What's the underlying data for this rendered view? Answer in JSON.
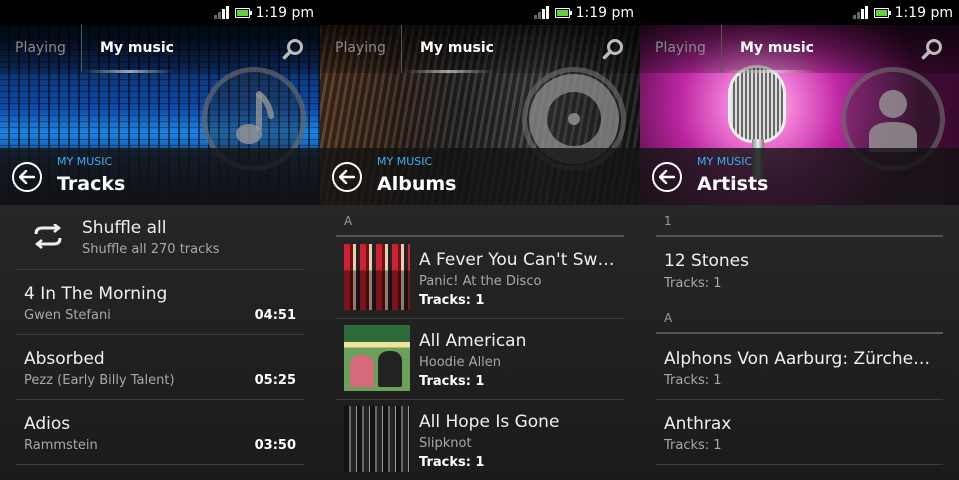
{
  "status": {
    "time": "1:19 pm"
  },
  "tabs": {
    "playing": "Playing",
    "my_music": "My music"
  },
  "panels": [
    {
      "crumb": "MY MUSIC",
      "title": "Tracks",
      "shuffle": {
        "label": "Shuffle all",
        "sub": "Shuffle all 270 tracks"
      },
      "tracks": [
        {
          "title": "4 In The Morning",
          "artist": "Gwen Stefani",
          "duration": "04:51"
        },
        {
          "title": "Absorbed",
          "artist": "Pezz (Early Billy Talent)",
          "duration": "05:25"
        },
        {
          "title": "Adios",
          "artist": "Rammstein",
          "duration": "03:50"
        }
      ]
    },
    {
      "crumb": "MY MUSIC",
      "title": "Albums",
      "section": "A",
      "albums": [
        {
          "title": "A Fever You Can't Swe...",
          "artist": "Panic! At the Disco",
          "tracks": "Tracks: 1"
        },
        {
          "title": "All American",
          "artist": "Hoodie Allen",
          "tracks": "Tracks: 1"
        },
        {
          "title": "All Hope Is Gone",
          "artist": "Slipknot",
          "tracks": "Tracks: 1"
        }
      ]
    },
    {
      "crumb": "MY MUSIC",
      "title": "Artists",
      "sections": [
        "1",
        "A"
      ],
      "artists": [
        {
          "name": "12 Stones",
          "tracks": "Tracks: 1"
        },
        {
          "name": "Alphons Von Aarburg: Zürcher S...",
          "tracks": "Tracks: 1"
        },
        {
          "name": "Anthrax",
          "tracks": "Tracks: 1"
        }
      ]
    }
  ],
  "icons": {
    "search": "search-icon",
    "back": "back-arrow-icon",
    "shuffle": "shuffle-icon",
    "tracks_category": "music-note-icon",
    "albums_category": "disc-icon",
    "artists_category": "person-icon"
  },
  "colors": {
    "accent": "#3ab0f0",
    "background": "#1a1a1a"
  }
}
